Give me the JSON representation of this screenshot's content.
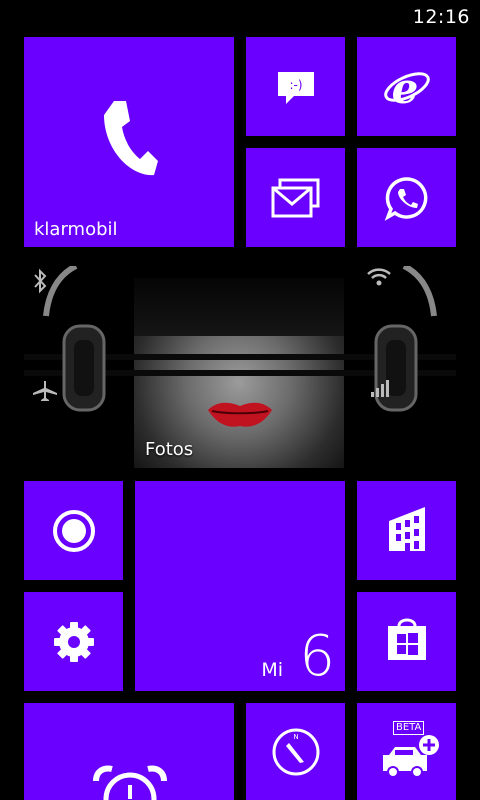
{
  "status_bar": {
    "time": "12:16"
  },
  "tiles": {
    "phone": {
      "label": "klarmobil",
      "icon": "phone-icon"
    },
    "messaging": {
      "icon": "messaging-smiley-icon"
    },
    "internet_explorer": {
      "icon": "internet-explorer-icon"
    },
    "mail": {
      "icon": "mail-icon"
    },
    "whatsapp": {
      "icon": "whatsapp-icon"
    },
    "photos": {
      "label": "Fotos"
    },
    "record": {
      "icon": "record-icon"
    },
    "calendar": {
      "weekday": "Mi",
      "day": "6"
    },
    "office": {
      "icon": "office-building-icon"
    },
    "settings": {
      "icon": "gear-icon"
    },
    "store": {
      "icon": "store-icon"
    },
    "alarms": {
      "icon": "alarm-clock-icon"
    },
    "maps": {
      "icon": "compass-icon"
    },
    "car_app": {
      "badge": "BETA",
      "icon": "car-add-icon"
    }
  },
  "colors": {
    "accent": "#6a00ff",
    "background": "#000000"
  }
}
